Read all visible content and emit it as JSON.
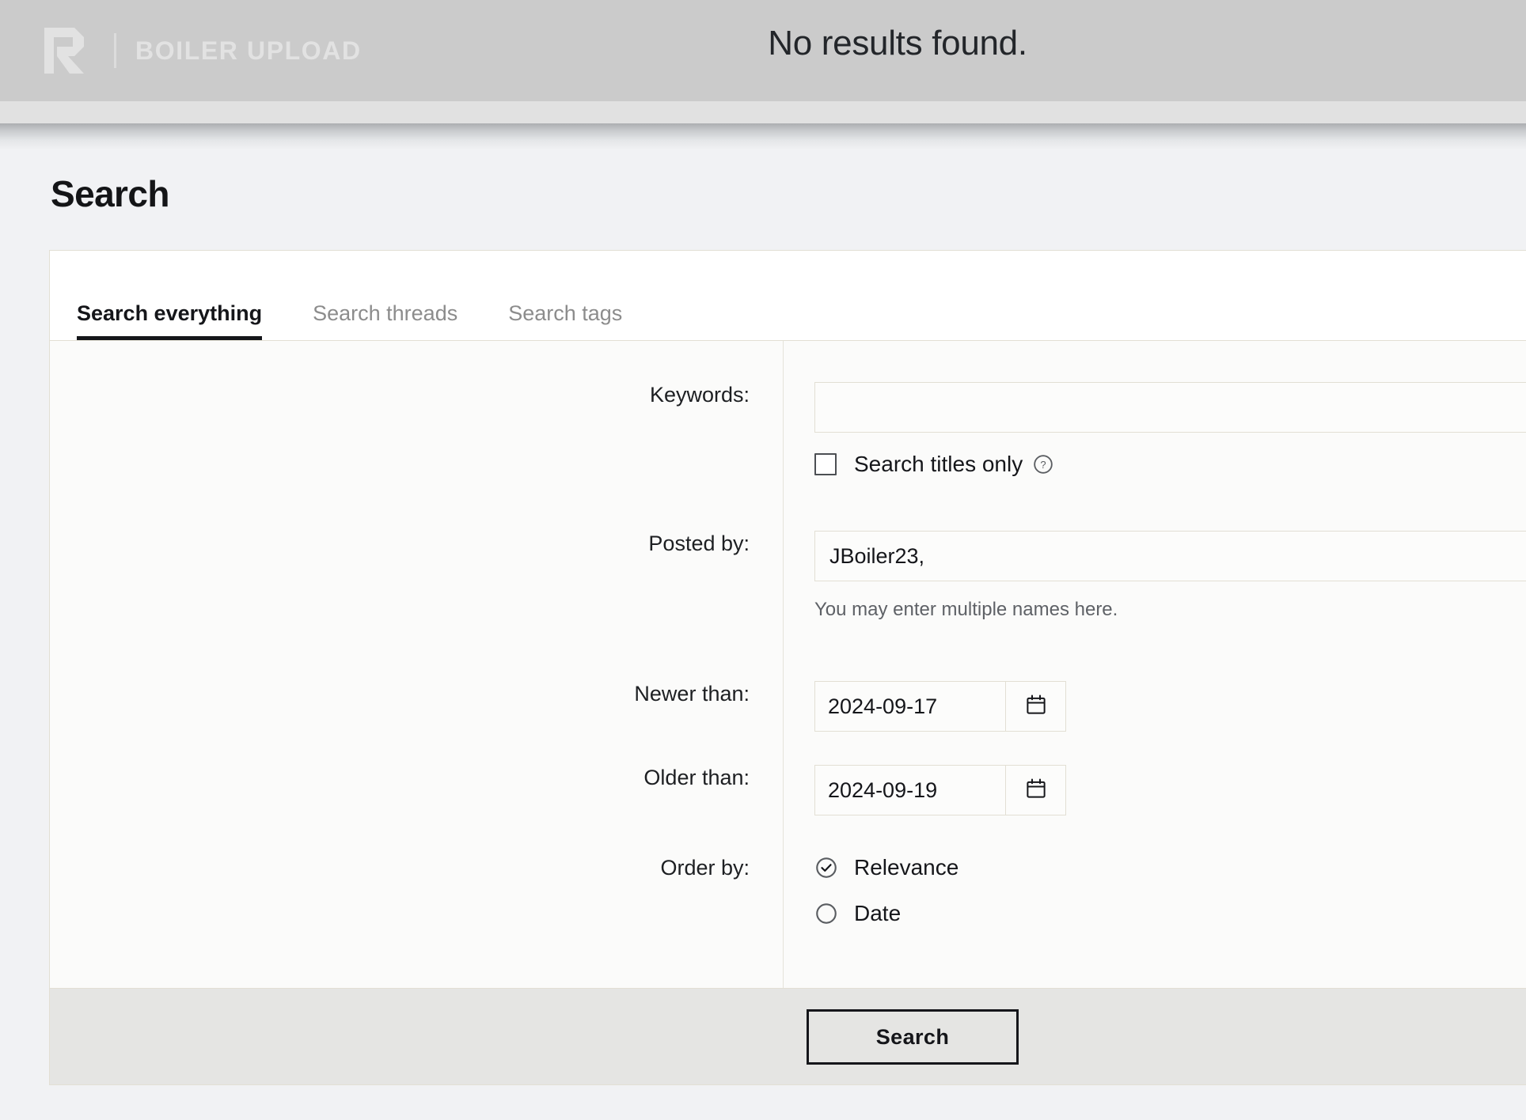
{
  "topbar": {
    "logo_icon": "r-logo-icon",
    "brand_name": "BOILER UPLOAD",
    "status_message": "No results found."
  },
  "page": {
    "title": "Search"
  },
  "tabs": [
    {
      "label": "Search everything",
      "active": true
    },
    {
      "label": "Search threads",
      "active": false
    },
    {
      "label": "Search tags",
      "active": false
    }
  ],
  "form": {
    "keywords": {
      "label": "Keywords:",
      "value": "",
      "placeholder": ""
    },
    "titles_only": {
      "label": "Search titles only",
      "checked": false,
      "help_icon": "question-circle-icon"
    },
    "posted_by": {
      "label": "Posted by:",
      "value": "JBoiler23,",
      "placeholder": "",
      "hint": "You may enter multiple names here."
    },
    "newer_than": {
      "label": "Newer than:",
      "value": "2024-09-17",
      "calendar_icon": "calendar-icon"
    },
    "older_than": {
      "label": "Older than:",
      "value": "2024-09-19",
      "calendar_icon": "calendar-icon"
    },
    "order_by": {
      "label": "Order by:",
      "options": [
        {
          "label": "Relevance",
          "selected": true
        },
        {
          "label": "Date",
          "selected": false
        }
      ]
    },
    "submit_label": "Search"
  },
  "colors": {
    "topbar_bg": "#cbcbcb",
    "page_bg": "#f1f2f4",
    "card_bg": "#fbfbfa",
    "border": "#e2dfd4",
    "text": "#15161a",
    "muted": "#8c8c8c",
    "footer_bg": "#e5e5e3"
  }
}
